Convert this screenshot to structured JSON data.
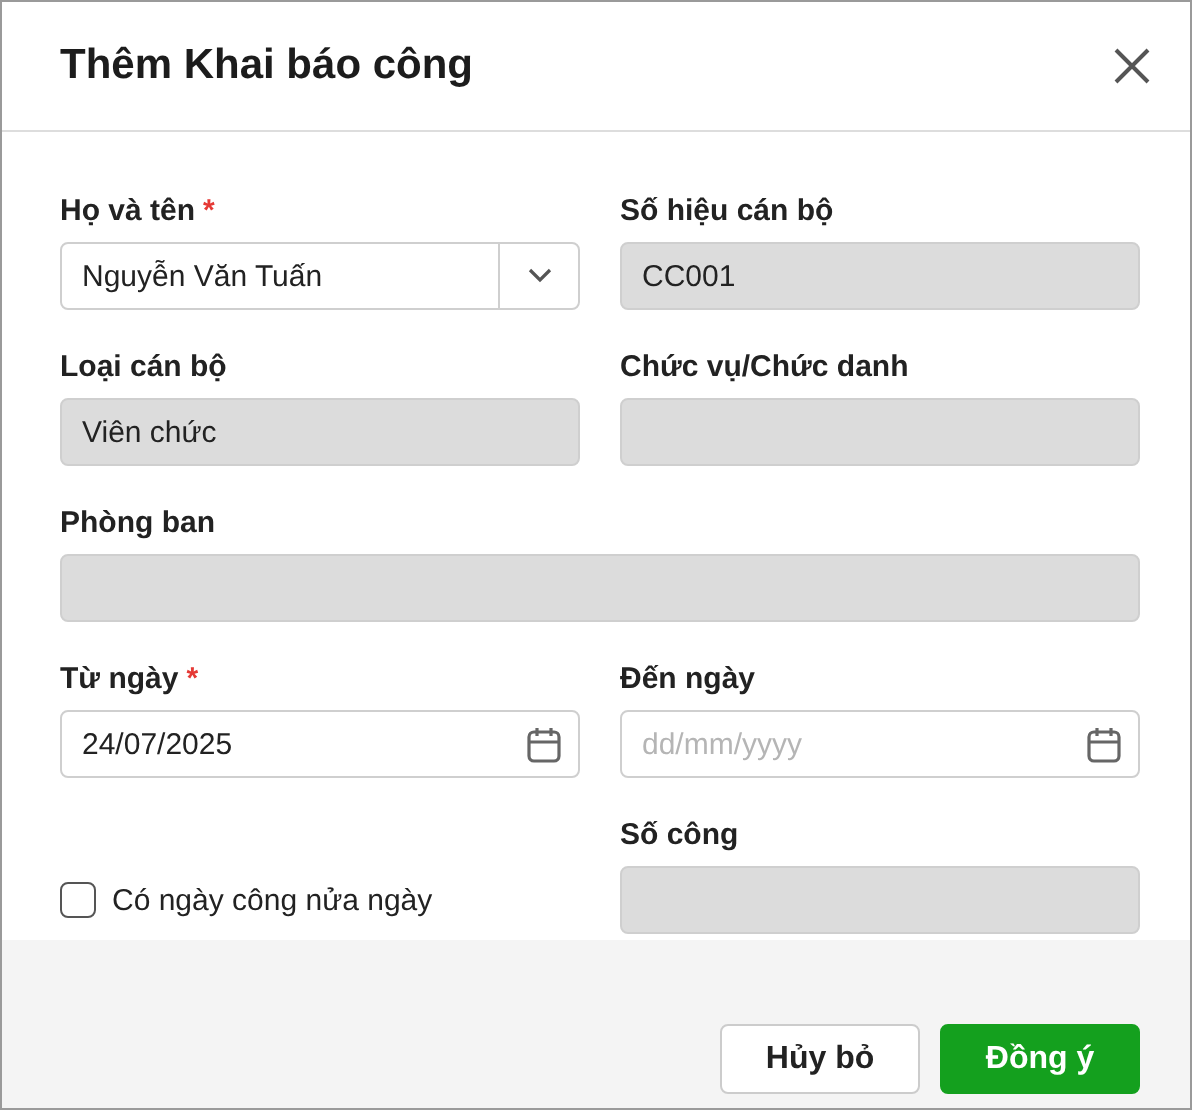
{
  "dialog": {
    "title": "Thêm Khai báo công"
  },
  "fields": [
    {
      "kind": "select",
      "label": "Họ và tên",
      "required_mark": "*",
      "value": "Nguyễn Văn Tuấn",
      "disabled": false,
      "wide": false
    },
    {
      "kind": "text",
      "label": "Số hiệu cán bộ",
      "value": "CC001",
      "disabled": true,
      "wide": false
    },
    {
      "kind": "text",
      "label": "Loại cán bộ",
      "value": "Viên chức",
      "disabled": true,
      "wide": false
    },
    {
      "kind": "text",
      "label": "Chức vụ/Chức danh",
      "disabled": true,
      "wide": false
    },
    {
      "kind": "text",
      "label": "Phòng ban",
      "disabled": true,
      "wide": true
    },
    {
      "kind": "date",
      "label": "Từ ngày",
      "required_mark": "*",
      "value": "24/07/2025",
      "disabled": false,
      "wide": false
    },
    {
      "kind": "date",
      "label": "Đến ngày",
      "placeholder": "dd/mm/yyyy",
      "disabled": false,
      "wide": false
    },
    {
      "kind": "checkbox",
      "label": "Có ngày công nửa ngày",
      "checked": false,
      "wide": false
    },
    {
      "kind": "text",
      "label": "Số công",
      "disabled": true,
      "wide": false
    }
  ],
  "buttons": [
    {
      "kind": "secondary",
      "label": "Hủy bỏ"
    },
    {
      "kind": "primary",
      "label": "Đồng ý"
    }
  ]
}
